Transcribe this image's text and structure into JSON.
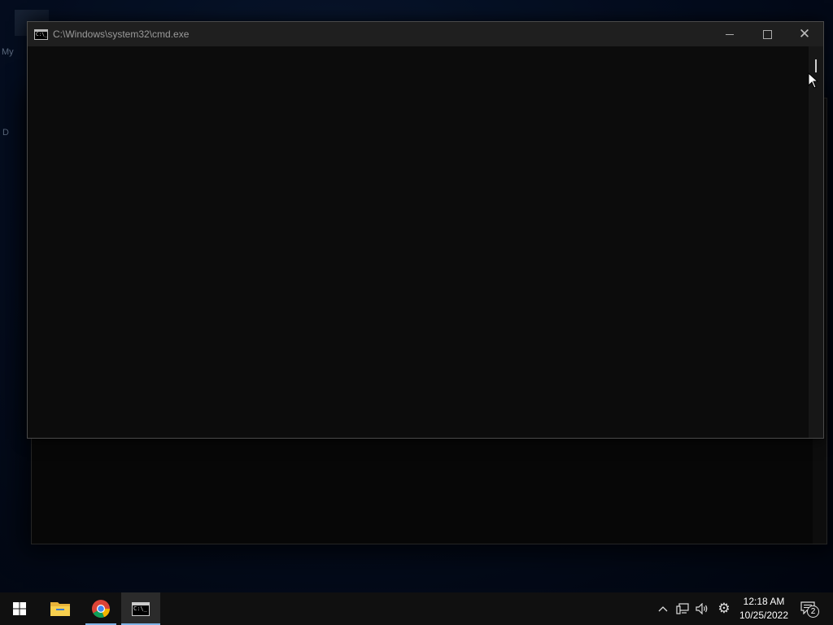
{
  "desktop": {
    "icon_label_fragment_1": "My",
    "icon_label_fragment_2": "D"
  },
  "cmd_window": {
    "title": "C:\\Windows\\system32\\cmd.exe",
    "icon_glyph": "C:\\_",
    "controls": {
      "minimize": "minimize-icon",
      "maximize": "maximize-icon",
      "close": "close-icon"
    },
    "console_text": ""
  },
  "taskbar": {
    "start": "windows-logo-icon",
    "pinned": [
      "file-explorer-icon",
      "chrome-icon",
      "cmd-icon"
    ],
    "cmd_task_glyph": "C:\\_",
    "tray": {
      "icons": [
        "chevron-up-icon",
        "network-icon",
        "volume-icon",
        "settings-icon"
      ],
      "time": "12:18 AM",
      "date": "10/25/2022",
      "notification_count": "2"
    }
  },
  "colors": {
    "accent": "#7fb3e6",
    "console_bg": "#0c0c0c",
    "titlebar_bg": "#1f1f1f",
    "taskbar_bg": "#101010"
  }
}
